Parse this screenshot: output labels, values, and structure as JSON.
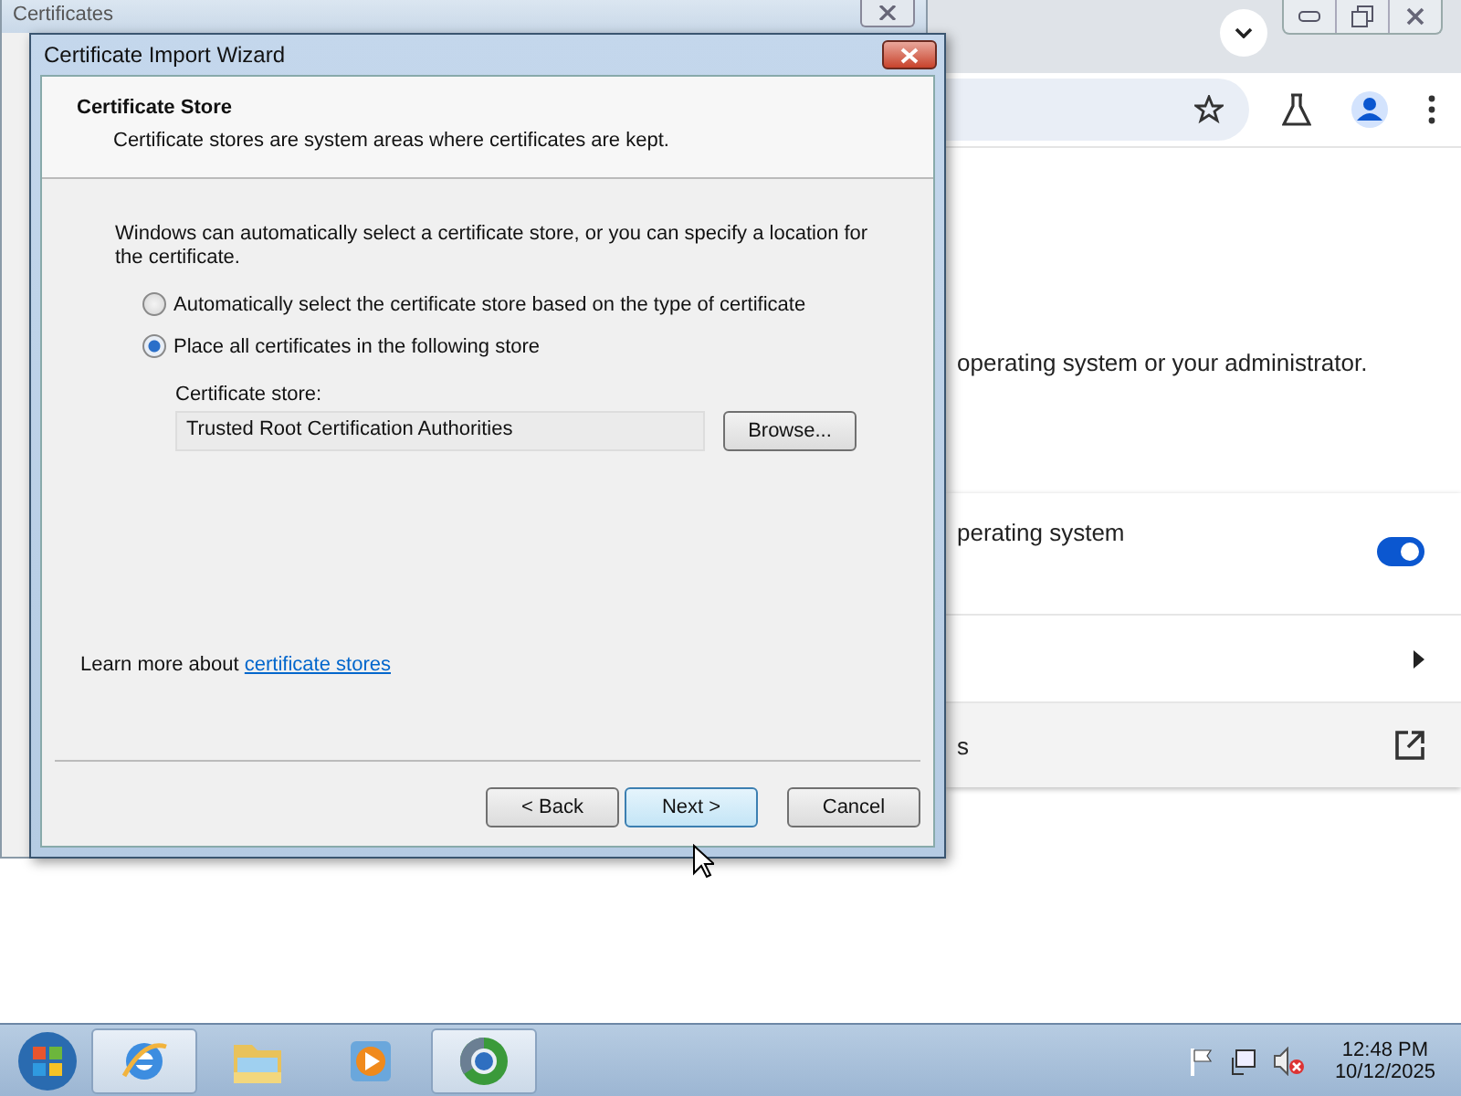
{
  "browser": {
    "content_text": "operating system or your administrator.",
    "card_rows": [
      {
        "kind": "toggle",
        "label": "perating system",
        "on": true
      },
      {
        "kind": "submenu"
      },
      {
        "kind": "external",
        "label": "s"
      }
    ]
  },
  "background_dialog": {
    "title": "Certificates"
  },
  "wizard": {
    "title": "Certificate Import Wizard",
    "heading": "Certificate Store",
    "subheading": "Certificate stores are system areas where certificates are kept.",
    "intro": "Windows can automatically select a certificate store, or you can specify a location for the certificate.",
    "options": [
      {
        "label": "Automatically select the certificate store based on the type of certificate",
        "selected": false
      },
      {
        "label": "Place all certificates in the following store",
        "selected": true
      }
    ],
    "store_label": "Certificate store:",
    "store_value": "Trusted Root Certification Authorities",
    "browse_button": "Browse...",
    "learn_more": {
      "text": "Learn more about",
      "link": "certificate stores"
    },
    "buttons": [
      {
        "label": "< Back",
        "default": false
      },
      {
        "label": "Next >",
        "default": true
      },
      {
        "label": "Cancel",
        "default": false
      }
    ]
  },
  "taskbar": {
    "apps": [
      {
        "kind": "browser-e",
        "running": true
      },
      {
        "kind": "folder",
        "running": false
      },
      {
        "kind": "media",
        "running": false
      },
      {
        "kind": "globe",
        "running": true
      }
    ],
    "clock": {
      "time": "12:48 PM",
      "date": "10/12/2025"
    }
  }
}
